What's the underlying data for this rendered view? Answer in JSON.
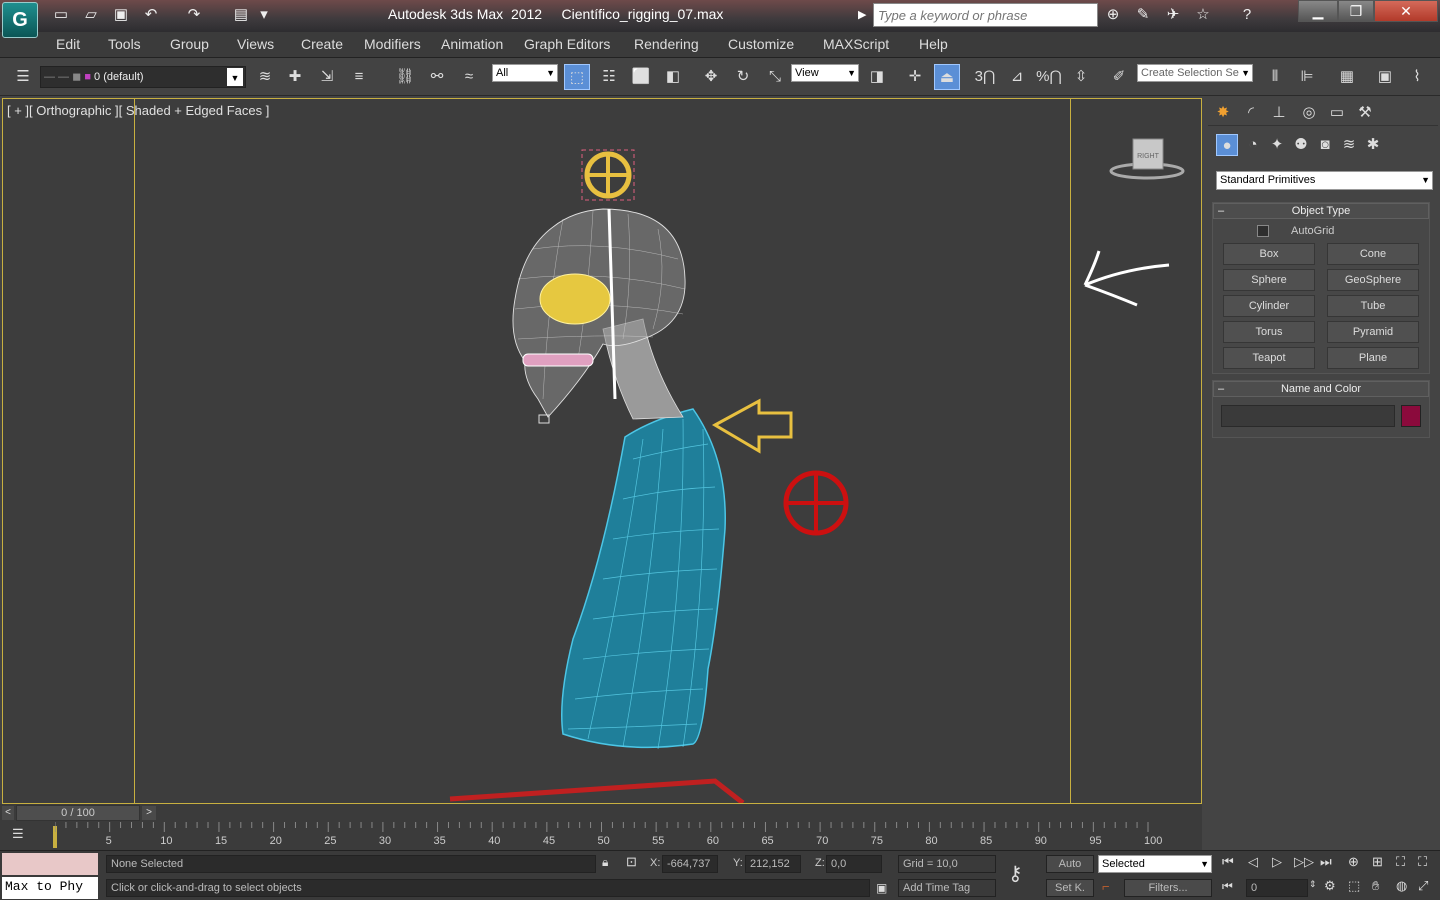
{
  "app": {
    "logo": "G",
    "title": "Autodesk 3ds Max  2012     Científico_rigging_07.max"
  },
  "search": {
    "placeholder": "Type a keyword or phrase"
  },
  "menu": [
    "Edit",
    "Tools",
    "Group",
    "Views",
    "Create",
    "Modifiers",
    "Animation",
    "Graph Editors",
    "Rendering",
    "Customize",
    "MAXScript",
    "Help"
  ],
  "toolbar": {
    "layer": "0 (default)",
    "selection_filter": "All",
    "ref_coord": "View",
    "named_selection": "Create Selection Se",
    "snap_labels": [
      "3",
      "%"
    ]
  },
  "viewport": {
    "label": "[ + ][ Orthographic ][ Shaded + Edged Faces ]",
    "viewcube_label": "RIGHT"
  },
  "command_panel": {
    "category": "Standard Primitives",
    "object_type_title": "Object Type",
    "autogrid": "AutoGrid",
    "buttons": [
      "Box",
      "Cone",
      "Sphere",
      "GeoSphere",
      "Cylinder",
      "Tube",
      "Torus",
      "Pyramid",
      "Teapot",
      "Plane"
    ],
    "name_color_title": "Name and Color",
    "object_color": "#8b0a3c"
  },
  "timeline": {
    "frame": "0 / 100",
    "ticks": [
      "5",
      "10",
      "15",
      "20",
      "25",
      "30",
      "35",
      "40",
      "45",
      "50",
      "55",
      "60",
      "65",
      "70",
      "75",
      "80",
      "85",
      "90",
      "95",
      "100"
    ]
  },
  "status": {
    "listener": "Max to Phy",
    "selection": "None Selected",
    "prompt": "Click or click-and-drag to select objects",
    "x": "-664,737",
    "y": "212,152",
    "z": "0,0",
    "x_label": "X:",
    "y_label": "Y:",
    "z_label": "Z:",
    "grid": "Grid = 10,0",
    "time_tag": "Add Time Tag",
    "auto_key": "Auto",
    "set_key": "Set K.",
    "key_filter": "Selected",
    "filters": "Filters...",
    "current_frame": "0"
  },
  "colors": {
    "accent": "#c8b040",
    "selected_blue": "#5b8fd6",
    "torso": "#1f7f9a"
  }
}
